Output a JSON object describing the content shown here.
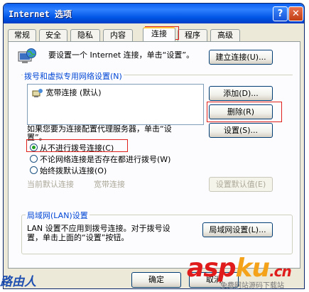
{
  "window": {
    "title": "Internet 选项",
    "help_glyph": "?",
    "close_glyph": "✕"
  },
  "tabs": [
    {
      "label": "常规"
    },
    {
      "label": "安全"
    },
    {
      "label": "隐私"
    },
    {
      "label": "内容"
    },
    {
      "label": "连接",
      "active": true
    },
    {
      "label": "程序"
    },
    {
      "label": "高级"
    }
  ],
  "setup": {
    "text": "要设置一个 Internet 连接，单击“设置”。",
    "button": "建立连接(U)..."
  },
  "dialup": {
    "group_label": "拨号和虚拟专用网络设置(N)",
    "list_items": [
      "宽带连接 (默认)"
    ],
    "add_button": "添加(D)...",
    "remove_button": "删除(R)",
    "settings_button": "设置(S)...",
    "proxy_text_line1": "如果您要为连接配置代理服务器，单击“设",
    "proxy_text_line2": "置”。",
    "radio_never": "从不进行拨号连接(C)",
    "radio_no_network": "不论网络连接是否存在都进行拨号(W)",
    "radio_always": "始终拨默认连接(O)",
    "current_default_label": "当前默认连接",
    "current_default_value": "宽带连接",
    "set_default_button": "设置默认值(E)"
  },
  "lan": {
    "group_label": "局域网(LAN)设置",
    "text_line1": "LAN 设置不应用到拨号连接。对于拨号设",
    "text_line2": "置，单击上面的“设置”按钮。",
    "button": "局域网设置(L)..."
  },
  "footer": {
    "ok_button": "确定",
    "cancel_button": "取消"
  },
  "watermark": {
    "left_text": "路由人",
    "brand_asp": "asp",
    "brand_ku": "ku",
    "brand_cn": ".cn",
    "subtext": "免费网站源码下载站"
  }
}
